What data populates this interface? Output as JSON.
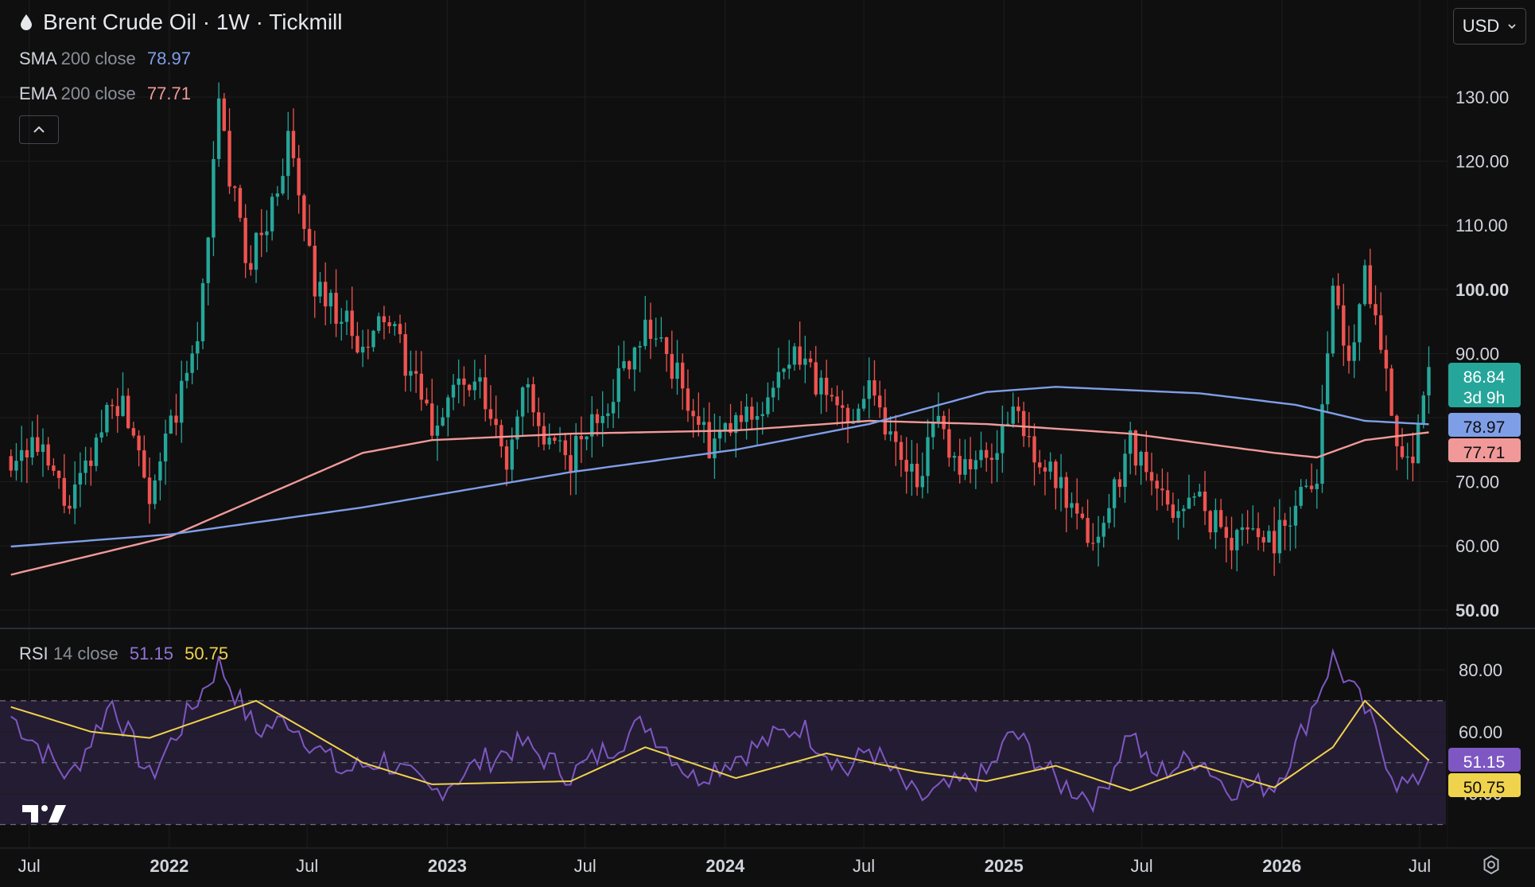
{
  "header": {
    "title": "Brent Crude Oil · 1W · Tickmill",
    "currency": "USD",
    "sma": {
      "name": "SMA",
      "params": "200 close",
      "value": "78.97"
    },
    "ema": {
      "name": "EMA",
      "params": "200 close",
      "value": "77.71"
    }
  },
  "rsi": {
    "name": "RSI",
    "params": "14 close",
    "value": "51.15",
    "ma_value": "50.75"
  },
  "colors": {
    "background": "#0f0f0f",
    "grid": "#1e1e1e",
    "up": "#26a69a",
    "down": "#ef5350",
    "sma": "#7f9ee8",
    "ema": "#f19999",
    "rsi": "#7e57c2",
    "rsi_ma": "#f0d34c",
    "axis_text": "#d1d4dc",
    "rsi_band": "#241c33"
  },
  "icons": {
    "drop": "drop-icon",
    "collapse": "chevron-up-icon",
    "currency_arrow": "chevron-down-icon",
    "settings": "gear-icon",
    "logo": "tradingview-logo"
  },
  "price_axis": {
    "ticks": [
      "130.00",
      "120.00",
      "110.00",
      "100.00",
      "90.00",
      "70.00",
      "60.00",
      "50.00"
    ],
    "bold": [
      "100.00",
      "50.00"
    ]
  },
  "badges": {
    "last_price": "86.84",
    "countdown": "3d 9h",
    "sma": "78.97",
    "ema": "77.71"
  },
  "rsi_axis": {
    "ticks": [
      "80.00",
      "60.00",
      "40.00"
    ],
    "badge_rsi": "51.15",
    "badge_ma": "50.75"
  },
  "time_axis": {
    "labels": [
      "Jul",
      "2022",
      "Jul",
      "2023",
      "Jul",
      "2024",
      "Jul",
      "2025",
      "Jul",
      "2026",
      "Jul"
    ],
    "bold": [
      "2022",
      "2023",
      "2024",
      "2025",
      "2026"
    ]
  },
  "chart_data": {
    "type": "candlestick",
    "title": "Brent Crude Oil · 1W · Tickmill",
    "x_range": [
      "2021-06",
      "2026-07"
    ],
    "ylim": [
      50,
      135
    ],
    "series_points": {
      "price_path": [
        [
          "2021-06-07",
          74
        ],
        [
          "2021-07-05",
          76
        ],
        [
          "2021-07-26",
          72
        ],
        [
          "2021-08-23",
          66
        ],
        [
          "2021-09-20",
          73
        ],
        [
          "2021-10-18",
          84
        ],
        [
          "2021-11-15",
          79
        ],
        [
          "2021-12-06",
          69
        ],
        [
          "2022-01-03",
          78
        ],
        [
          "2022-02-07",
          92
        ],
        [
          "2022-03-07",
          128
        ],
        [
          "2022-04-11",
          104
        ],
        [
          "2022-05-09",
          110
        ],
        [
          "2022-06-06",
          123
        ],
        [
          "2022-07-11",
          101
        ],
        [
          "2022-08-15",
          96
        ],
        [
          "2022-09-12",
          89
        ],
        [
          "2022-10-10",
          96
        ],
        [
          "2022-11-14",
          87
        ],
        [
          "2022-12-12",
          78
        ],
        [
          "2023-01-09",
          85
        ],
        [
          "2023-02-13",
          84
        ],
        [
          "2023-03-20",
          73
        ],
        [
          "2023-04-10",
          86
        ],
        [
          "2023-05-08",
          75
        ],
        [
          "2023-06-12",
          74
        ],
        [
          "2023-07-17",
          80
        ],
        [
          "2023-08-14",
          86
        ],
        [
          "2023-09-18",
          95
        ],
        [
          "2023-10-16",
          90
        ],
        [
          "2023-11-20",
          81
        ],
        [
          "2023-12-11",
          75
        ],
        [
          "2024-01-15",
          79
        ],
        [
          "2024-02-19",
          82
        ],
        [
          "2024-04-08",
          90
        ],
        [
          "2024-05-13",
          83
        ],
        [
          "2024-06-10",
          80
        ],
        [
          "2024-07-08",
          86
        ],
        [
          "2024-08-05",
          77
        ],
        [
          "2024-09-09",
          71
        ],
        [
          "2024-10-07",
          79
        ],
        [
          "2024-11-04",
          73
        ],
        [
          "2024-12-09",
          73
        ],
        [
          "2025-01-13",
          81
        ],
        [
          "2025-02-10",
          75
        ],
        [
          "2025-03-10",
          70
        ],
        [
          "2025-04-07",
          63
        ],
        [
          "2025-05-05",
          61
        ],
        [
          "2025-06-16",
          77
        ],
        [
          "2025-07-14",
          69
        ],
        [
          "2025-08-11",
          66
        ],
        [
          "2025-09-15",
          67
        ],
        [
          "2025-10-20",
          61
        ],
        [
          "2025-11-17",
          63
        ],
        [
          "2025-12-22",
          61
        ],
        [
          "2026-01-19",
          67
        ],
        [
          "2026-02-16",
          72
        ],
        [
          "2026-03-09",
          100
        ],
        [
          "2026-03-30",
          88
        ],
        [
          "2026-04-20",
          104
        ],
        [
          "2026-05-11",
          92
        ],
        [
          "2026-06-01",
          77
        ],
        [
          "2026-06-22",
          72
        ],
        [
          "2026-07-13",
          86
        ]
      ],
      "sma_200": [
        [
          "2021-06-07",
          59.9
        ],
        [
          "2022-01-03",
          61.8
        ],
        [
          "2022-09-12",
          66.0
        ],
        [
          "2023-06-12",
          71.5
        ],
        [
          "2024-01-15",
          75.0
        ],
        [
          "2024-07-08",
          79.0
        ],
        [
          "2024-12-09",
          84.0
        ],
        [
          "2025-03-10",
          84.8
        ],
        [
          "2025-09-15",
          83.8
        ],
        [
          "2026-01-19",
          82.0
        ],
        [
          "2026-04-20",
          79.5
        ],
        [
          "2026-07-13",
          78.97
        ]
      ],
      "ema_200": [
        [
          "2021-06-07",
          55.5
        ],
        [
          "2022-01-03",
          61.5
        ],
        [
          "2022-09-12",
          74.5
        ],
        [
          "2022-12-12",
          76.5
        ],
        [
          "2023-06-12",
          77.5
        ],
        [
          "2024-01-15",
          78.0
        ],
        [
          "2024-07-08",
          79.5
        ],
        [
          "2024-12-09",
          79.0
        ],
        [
          "2025-06-16",
          77.5
        ],
        [
          "2025-12-22",
          74.5
        ],
        [
          "2026-02-16",
          73.8
        ],
        [
          "2026-04-20",
          76.5
        ],
        [
          "2026-07-13",
          77.71
        ]
      ]
    },
    "rsi": {
      "name": "RSI 14 close",
      "ylim": [
        30,
        92
      ],
      "levels": [
        70,
        50,
        30
      ],
      "points": [
        [
          "2021-06-07",
          65
        ],
        [
          "2021-08-23",
          45
        ],
        [
          "2021-10-18",
          70
        ],
        [
          "2021-12-06",
          45
        ],
        [
          "2022-03-07",
          82
        ],
        [
          "2022-04-25",
          60
        ],
        [
          "2022-06-06",
          64
        ],
        [
          "2022-08-15",
          47
        ],
        [
          "2022-10-10",
          51
        ],
        [
          "2022-12-12",
          40
        ],
        [
          "2023-02-13",
          50
        ],
        [
          "2023-04-10",
          56
        ],
        [
          "2023-06-12",
          46
        ],
        [
          "2023-09-18",
          63
        ],
        [
          "2023-11-20",
          45
        ],
        [
          "2024-01-15",
          52
        ],
        [
          "2024-04-08",
          62
        ],
        [
          "2024-06-10",
          47
        ],
        [
          "2024-07-08",
          55
        ],
        [
          "2024-09-09",
          38
        ],
        [
          "2024-12-09",
          46
        ],
        [
          "2025-01-13",
          60
        ],
        [
          "2025-03-10",
          44
        ],
        [
          "2025-05-05",
          38
        ],
        [
          "2025-06-16",
          61
        ],
        [
          "2025-07-14",
          46
        ],
        [
          "2025-09-15",
          52
        ],
        [
          "2025-10-20",
          42
        ],
        [
          "2025-12-22",
          43
        ],
        [
          "2026-01-19",
          55
        ],
        [
          "2026-03-09",
          84
        ],
        [
          "2026-04-20",
          67
        ],
        [
          "2026-06-01",
          44
        ],
        [
          "2026-06-22",
          42
        ],
        [
          "2026-07-13",
          51.15
        ]
      ],
      "ma": [
        [
          "2021-06-07",
          68
        ],
        [
          "2021-09-20",
          60
        ],
        [
          "2021-12-06",
          58
        ],
        [
          "2022-04-25",
          70
        ],
        [
          "2022-09-12",
          50
        ],
        [
          "2022-12-12",
          43
        ],
        [
          "2023-06-12",
          44
        ],
        [
          "2023-09-18",
          55
        ],
        [
          "2024-01-15",
          45
        ],
        [
          "2024-05-13",
          53
        ],
        [
          "2024-09-09",
          47
        ],
        [
          "2024-12-09",
          44
        ],
        [
          "2025-03-10",
          49
        ],
        [
          "2025-06-16",
          41
        ],
        [
          "2025-09-15",
          49
        ],
        [
          "2025-12-22",
          42
        ],
        [
          "2026-03-09",
          55
        ],
        [
          "2026-04-20",
          70
        ],
        [
          "2026-06-01",
          60
        ],
        [
          "2026-07-13",
          50.75
        ]
      ]
    }
  }
}
